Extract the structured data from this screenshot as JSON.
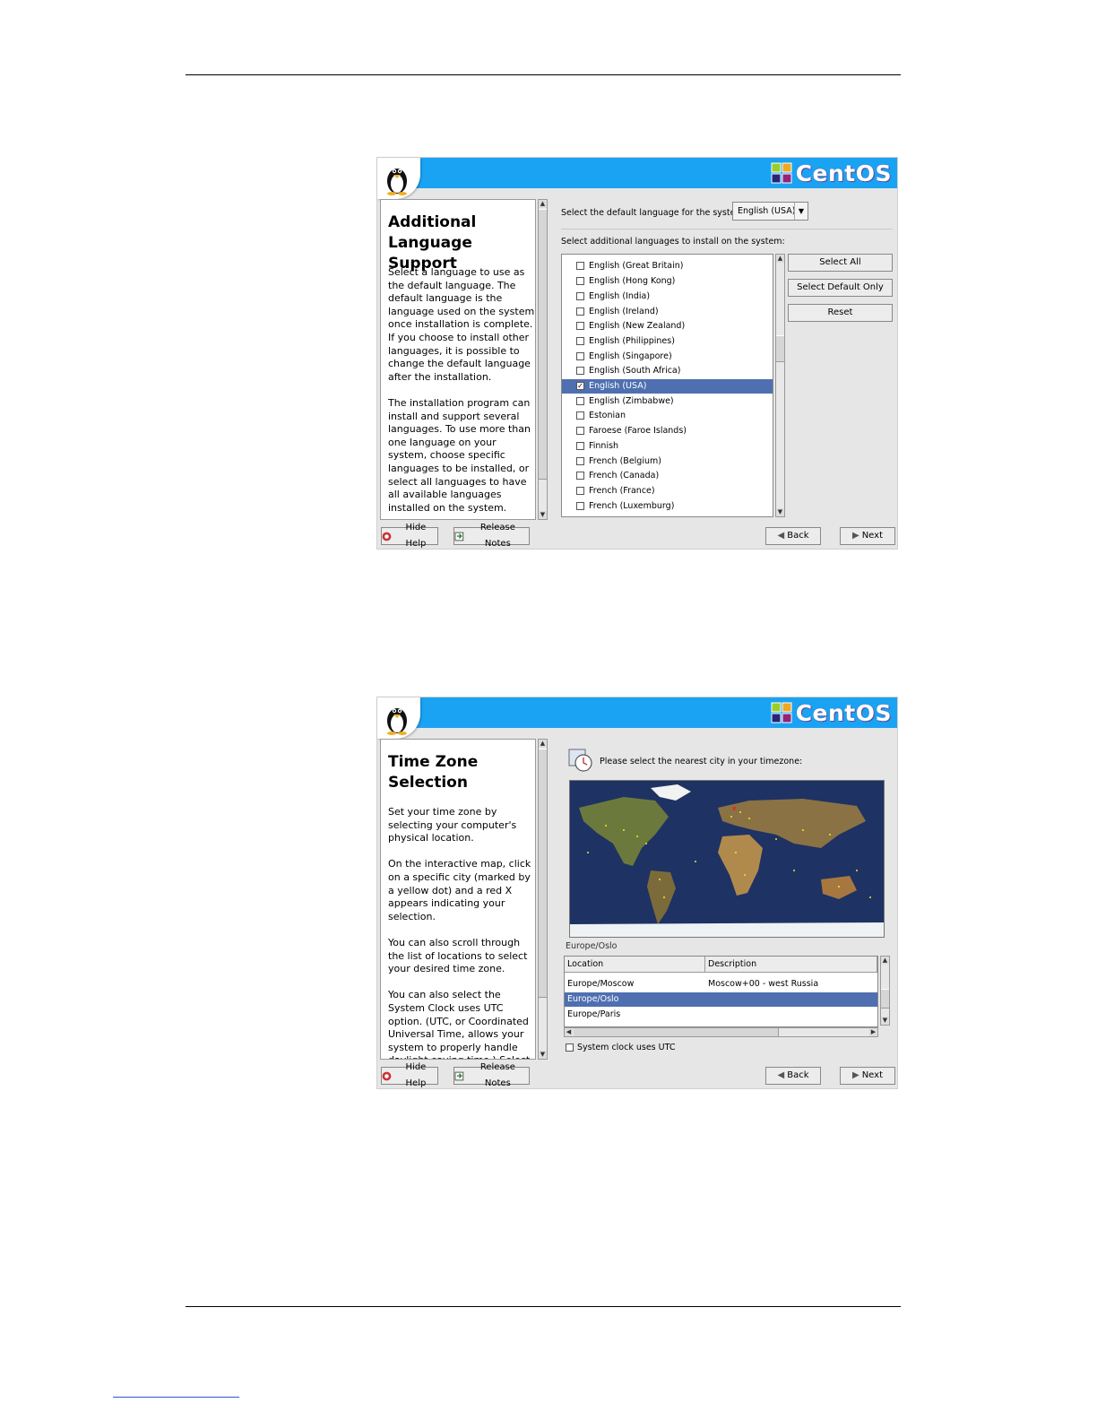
{
  "common": {
    "brand": "CentOS",
    "hide_help": "Hide Help",
    "release_notes": "Release Notes",
    "back": "Back",
    "next": "Next"
  },
  "screen1": {
    "help_title": "Additional Language Support",
    "help_paragraphs": [
      "Select a language to use as the default language. The default language is the language used on the system once installation is complete. If you choose to install other languages, it is possible to change the default language after the installation.",
      "The installation program can install and support several languages. To use more than one language on your system, choose specific languages to be installed, or select all languages to have all available languages installed on the system."
    ],
    "default_lang_label": "Select the default language for the system:",
    "default_lang_value": "English (USA)",
    "additional_label": "Select additional languages to install on the system:",
    "languages": [
      {
        "label": "English (Great Britain)",
        "checked": false
      },
      {
        "label": "English (Hong Kong)",
        "checked": false
      },
      {
        "label": "English (India)",
        "checked": false
      },
      {
        "label": "English (Ireland)",
        "checked": false
      },
      {
        "label": "English (New Zealand)",
        "checked": false
      },
      {
        "label": "English (Philippines)",
        "checked": false
      },
      {
        "label": "English (Singapore)",
        "checked": false
      },
      {
        "label": "English (South Africa)",
        "checked": false
      },
      {
        "label": "English (USA)",
        "checked": true
      },
      {
        "label": "English (Zimbabwe)",
        "checked": false
      },
      {
        "label": "Estonian",
        "checked": false
      },
      {
        "label": "Faroese (Faroe Islands)",
        "checked": false
      },
      {
        "label": "Finnish",
        "checked": false
      },
      {
        "label": "French (Belgium)",
        "checked": false
      },
      {
        "label": "French (Canada)",
        "checked": false
      },
      {
        "label": "French (France)",
        "checked": false
      },
      {
        "label": "French (Luxemburg)",
        "checked": false
      }
    ],
    "select_all": "Select All",
    "select_default_only": "Select Default Only",
    "reset": "Reset"
  },
  "screen2": {
    "help_title": "Time Zone Selection",
    "help_paragraphs": [
      "Set your time zone by selecting your computer's physical location.",
      "On the interactive map, click on a specific city (marked by a yellow dot) and a red X appears indicating your selection.",
      "You can also scroll through the list of locations to select your desired time zone.",
      "You can also select the System Clock uses UTC option. (UTC, or Coordinated Universal Time, allows your system to properly handle daylight-saving time.) Select"
    ],
    "prompt": "Please select the nearest city in your timezone:",
    "selected_zone": "Europe/Oslo",
    "col_location": "Location",
    "col_description": "Description",
    "rows": [
      {
        "location": "Europe/Moscow",
        "description": "Moscow+00 - west Russia"
      },
      {
        "location": "Europe/Oslo",
        "description": ""
      },
      {
        "location": "Europe/Paris",
        "description": ""
      }
    ],
    "utc_label": "System clock uses UTC"
  }
}
